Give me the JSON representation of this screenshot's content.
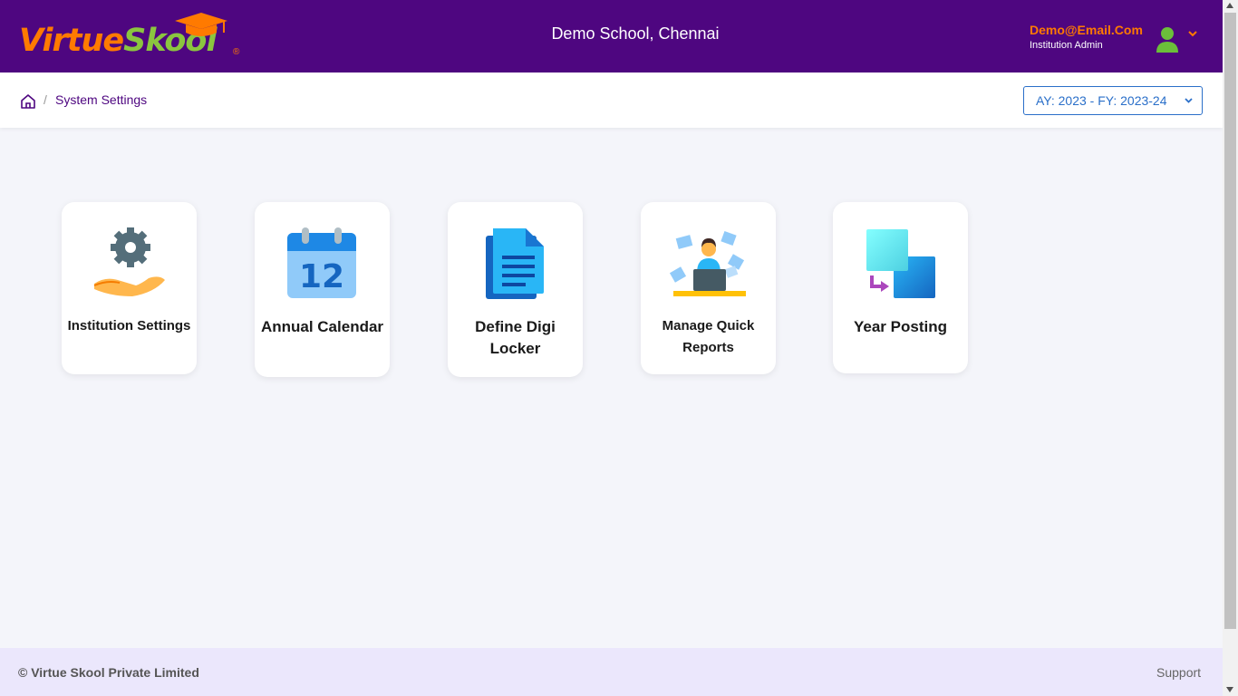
{
  "header": {
    "logo_text_a": "Virtue",
    "logo_text_b": "Skool",
    "logo_reg": "®",
    "school_name": "Demo School, Chennai",
    "user_email": "Demo@Email.Com",
    "user_role": "Institution Admin"
  },
  "breadcrumb": {
    "separator": "/",
    "current": "System Settings"
  },
  "year_select": {
    "value": "AY: 2023 - FY: 2023-24"
  },
  "cards": [
    {
      "label": "Institution Settings",
      "icon": "gear-hand-icon"
    },
    {
      "label": "Annual Calendar",
      "icon": "calendar-icon",
      "icon_text": "12"
    },
    {
      "label": "Define Digi Locker",
      "icon": "document-icon"
    },
    {
      "label": "Manage Quick Reports",
      "icon": "reports-person-icon"
    },
    {
      "label": "Year Posting",
      "icon": "year-posting-icon"
    }
  ],
  "footer": {
    "copyright": "© Virtue Skool Private Limited",
    "support": "Support"
  },
  "colors": {
    "header_bg": "#4e0680",
    "accent_orange": "#ff7a00",
    "accent_green": "#8bc53f",
    "select_blue": "#2a6fc9",
    "footer_bg": "#ebe7fc"
  }
}
